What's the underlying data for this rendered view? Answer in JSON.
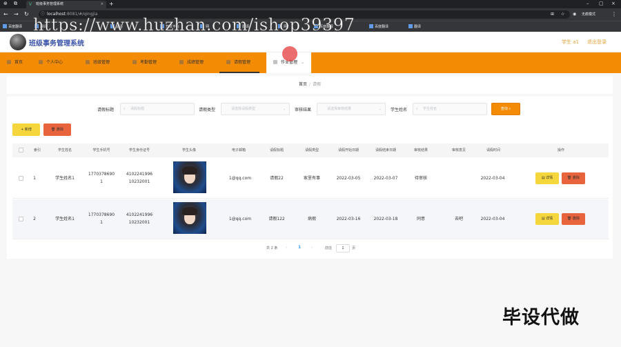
{
  "browser": {
    "tab_title": "班级事务管理系统",
    "url_host": "localhost",
    "url_rest": ":8081/#/qingjia",
    "incognito_label": "无痕模式",
    "bookmarks": [
      "百度翻译",
      "翻译",
      "翻译",
      "开发平台",
      "网",
      "翻译",
      "网",
      "百度翻译",
      "百度翻译",
      "翻译"
    ],
    "watermark": "https://www.huzhan.com/ishop39397"
  },
  "header": {
    "title": "班级事务管理系统",
    "user": "学生 a1",
    "logout": "退出登录"
  },
  "menu": {
    "items": [
      "首页",
      "个人中心",
      "班级管理",
      "考勤管理",
      "成绩管理",
      "请假管理",
      "作业管理"
    ],
    "dropdown_arrow": "⌄"
  },
  "breadcrumb": {
    "home": "首页",
    "separator": "/",
    "current": "请假"
  },
  "filters": {
    "title_label": "请假标题",
    "title_placeholder": "请假标题",
    "type_label": "请假类型",
    "type_placeholder": "请选择请假类型",
    "review_label": "审核结果",
    "review_placeholder": "请选择审核结果",
    "name_label": "学生姓名",
    "name_placeholder": "学生姓名",
    "search_button": "查询"
  },
  "actions": {
    "add": "+ 新增",
    "delete": "删除"
  },
  "table": {
    "headers": [
      "索引",
      "学生姓名",
      "学生手机号",
      "学生身份证号",
      "学生头像",
      "电子邮箱",
      "请假标题",
      "请假类型",
      "请假开始日期",
      "请假结束日期",
      "审核结果",
      "审核意见",
      "请假时间",
      "操作"
    ],
    "rows": [
      {
        "index": "1",
        "name": "学生姓名1",
        "phone1": "1770378690",
        "phone2": "1",
        "idcard1": "4102241996",
        "idcard2": "10232001",
        "email": "1@qq.com",
        "title": "请假22",
        "type": "家里有事",
        "start": "2022-03-05",
        "end": "2022-03-07",
        "review": "待审核",
        "opinion": "",
        "time": "2022-03-04",
        "detail_btn": "详情",
        "delete_btn": "删除"
      },
      {
        "index": "2",
        "name": "学生姓名1",
        "phone1": "1770378690",
        "phone2": "1",
        "idcard1": "4102241996",
        "idcard2": "10232001",
        "email": "1@qq.com",
        "title": "请假122",
        "type": "病假",
        "start": "2022-03-16",
        "end": "2022-03-18",
        "review": "同意",
        "opinion": "去吧",
        "time": "2022-03-04",
        "detail_btn": "详情",
        "delete_btn": "删除"
      }
    ]
  },
  "pagination": {
    "total": "共 2 条",
    "prev": "‹",
    "page": "1",
    "next": "›",
    "goto": "前往",
    "goto_value": "1",
    "page_unit": "页"
  },
  "corner_text": "毕设代做"
}
